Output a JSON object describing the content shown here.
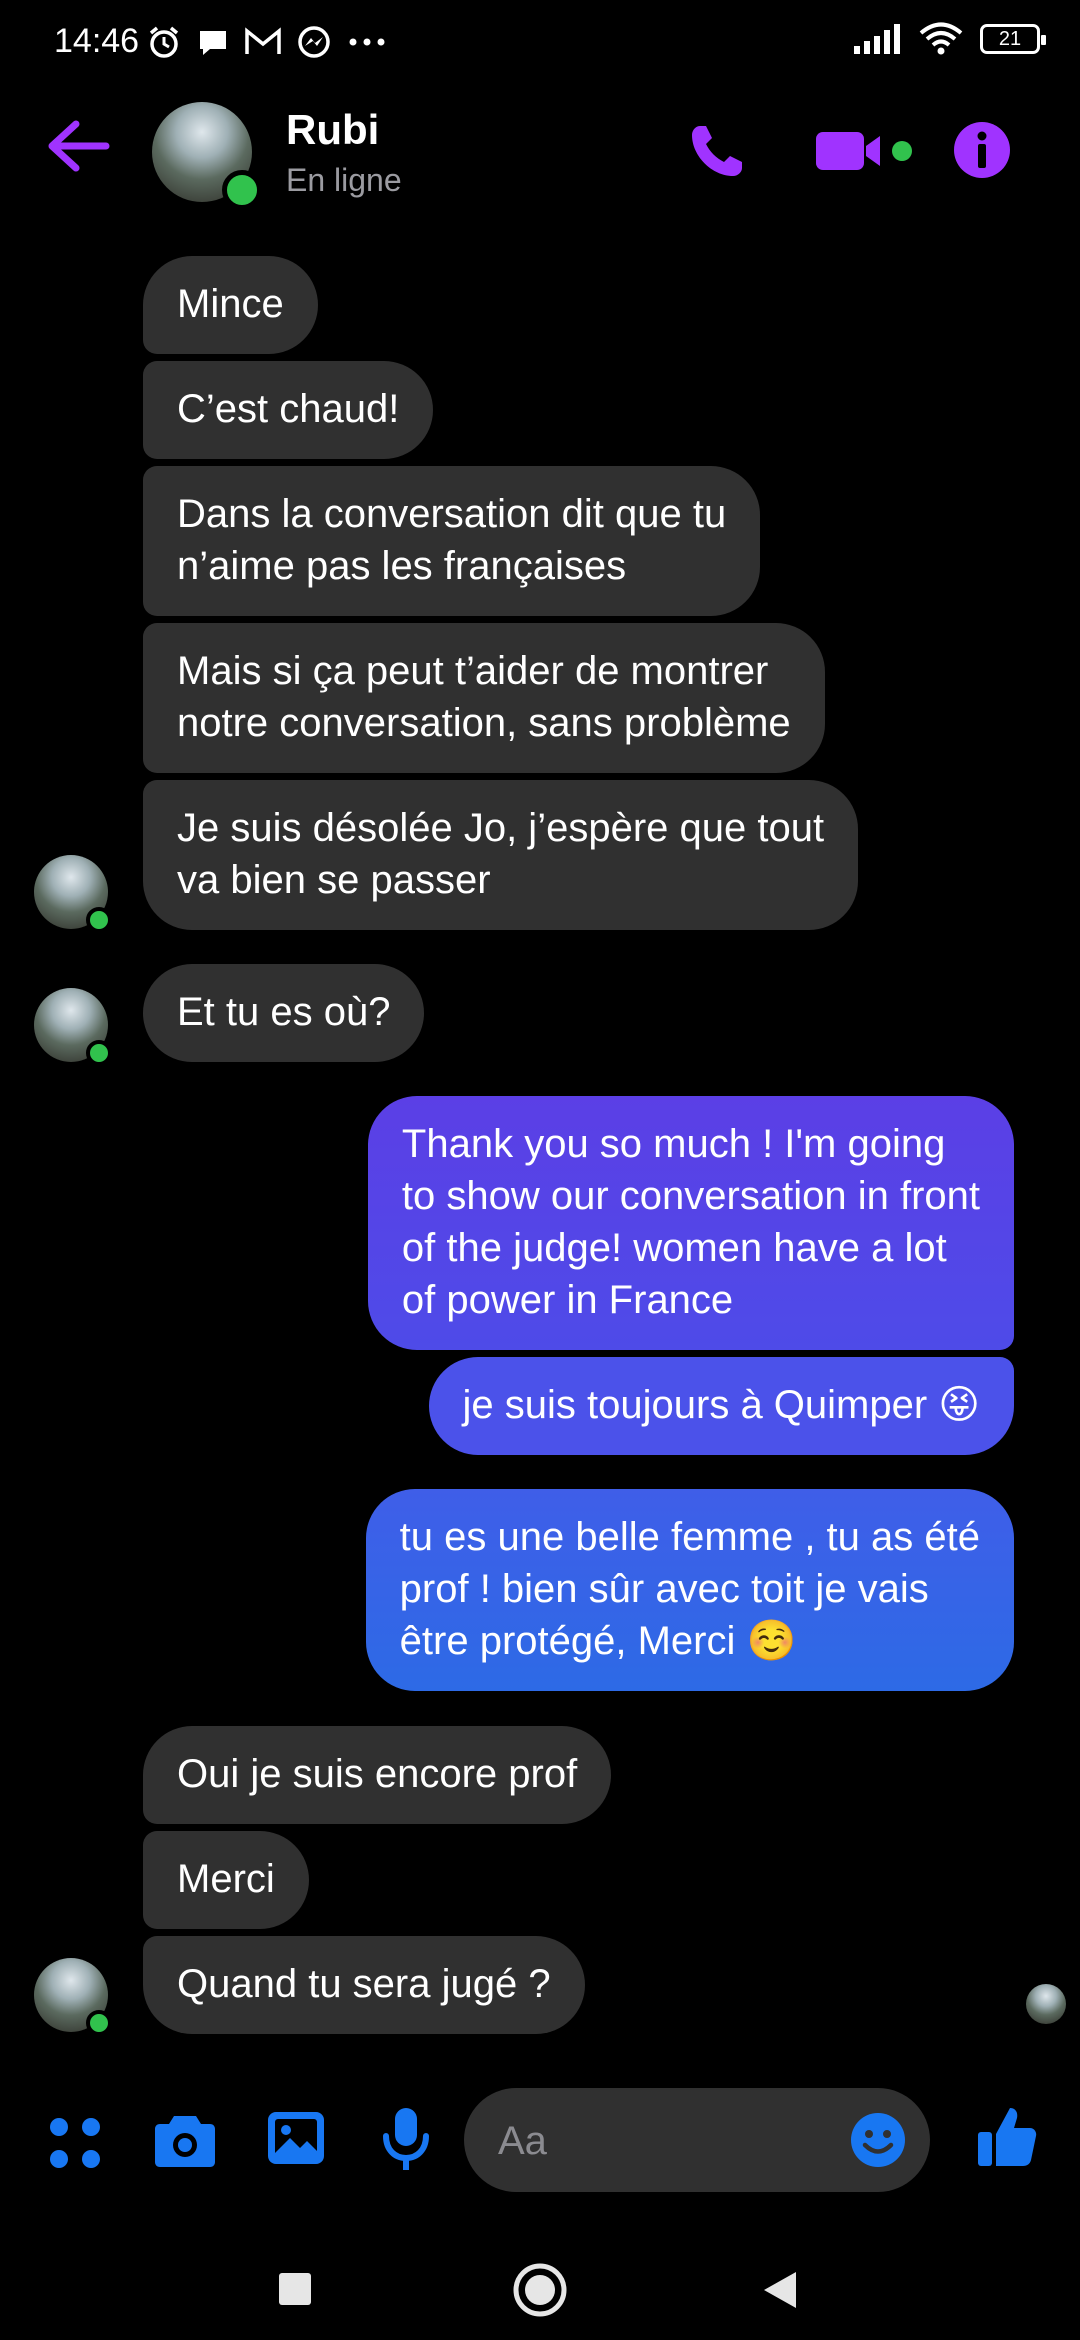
{
  "status_bar": {
    "time": "14:46",
    "battery": "21",
    "left_icons": [
      "alarm-icon",
      "chat-bubble-icon",
      "gmail-icon",
      "messenger-icon",
      "more-dots-icon"
    ],
    "right_icons": [
      "signal-icon",
      "wifi-icon",
      "battery-icon"
    ]
  },
  "header": {
    "name": "Rubi",
    "status": "En ligne",
    "accent_color": "#a033ff",
    "online_color": "#31c24d",
    "icons": [
      "back-arrow-icon",
      "phone-icon",
      "video-camera-icon",
      "info-icon"
    ]
  },
  "messages": [
    {
      "sender": "Rubi",
      "text": "Mince"
    },
    {
      "sender": "Rubi",
      "text": "C’est chaud!"
    },
    {
      "sender": "Rubi",
      "lines": [
        "Dans la conversation dit que tu",
        "n’aime pas les françaises"
      ]
    },
    {
      "sender": "Rubi",
      "lines": [
        "Mais si ça peut t’aider de montrer",
        "notre conversation, sans problème"
      ]
    },
    {
      "sender": "Rubi",
      "lines": [
        "Je suis désolée Jo, j’espère que tout",
        "va bien se passer"
      ]
    },
    {
      "sender": "Rubi",
      "text": "Et tu es où?"
    },
    {
      "sender": "me",
      "lines": [
        "Thank you so much !  I'm going",
        "to show our conversation in front",
        "of the judge!  women have a lot",
        "of power in France"
      ]
    },
    {
      "sender": "me",
      "text": "je suis toujours à Quimper 😝"
    },
    {
      "sender": "me",
      "lines": [
        "tu es une belle femme , tu as été",
        "prof ! bien sûr avec toit je vais",
        "être protégé, Merci ☺️"
      ]
    },
    {
      "sender": "Rubi",
      "text": "Oui je suis encore prof"
    },
    {
      "sender": "Rubi",
      "text": "Merci"
    },
    {
      "sender": "Rubi",
      "text": "Quand tu sera jugé ?"
    }
  ],
  "composer": {
    "placeholder": "Aa",
    "icon_color": "#1877f2",
    "icons": [
      "apps-grid-icon",
      "camera-icon",
      "gallery-icon",
      "microphone-icon",
      "emoji-icon",
      "thumbs-up-icon"
    ]
  },
  "nav_bar": {
    "icons": [
      "recents-square-icon",
      "home-circle-icon",
      "back-triangle-icon"
    ]
  }
}
